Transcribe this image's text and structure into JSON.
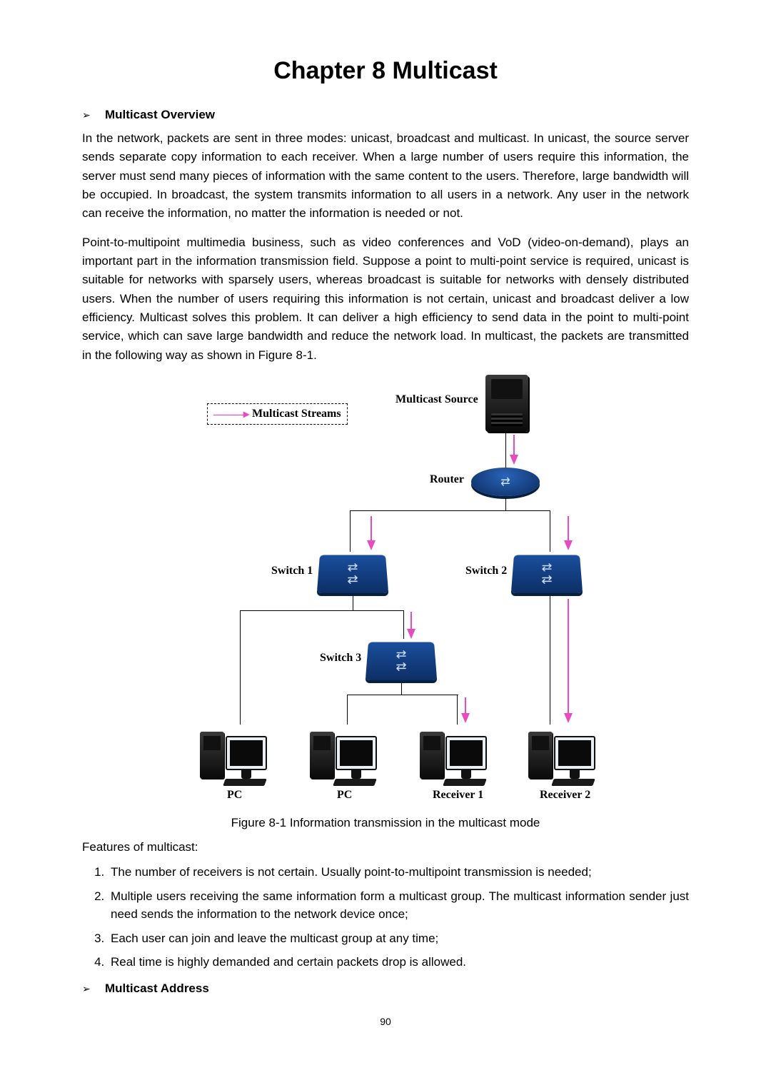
{
  "title": "Chapter 8  Multicast",
  "sections": {
    "overview_label": "Multicast Overview",
    "address_label": "Multicast Address"
  },
  "paragraphs": {
    "p1": "In the network, packets are sent in three modes: unicast, broadcast and multicast. In unicast, the source server sends separate copy information to each receiver. When a large number of users require this information, the server must send many pieces of information with the same content to the users. Therefore, large bandwidth will be occupied. In broadcast, the system transmits information to all users in a network. Any user in the network can receive the information, no matter the information is needed or not.",
    "p2": "Point-to-multipoint multimedia business, such as video conferences and VoD (video-on-demand), plays an important part in the information transmission field. Suppose a point to multi-point service is required, unicast is suitable for networks with sparsely users, whereas broadcast is suitable for networks with densely distributed users. When the number of users requiring this information is not certain, unicast and broadcast deliver a low efficiency. Multicast solves this problem. It can deliver a high efficiency to send data in the point to multi-point service, which can save large bandwidth and reduce the network load. In multicast, the packets are transmitted in the following way as shown in Figure 8-1."
  },
  "figure": {
    "caption": "Figure 8-1 Information transmission in the multicast mode",
    "legend": "Multicast Streams",
    "labels": {
      "source": "Multicast Source",
      "router": "Router",
      "switch1": "Switch 1",
      "switch2": "Switch 2",
      "switch3": "Switch 3",
      "pc": "PC",
      "receiver1": "Receiver 1",
      "receiver2": "Receiver 2"
    }
  },
  "features": {
    "intro": "Features of multicast:",
    "items": [
      "The number of receivers is not certain. Usually point-to-multipoint transmission is needed;",
      "Multiple users receiving the same information form a multicast group. The multicast information sender just need sends the information to the network device once;",
      "Each user can join and leave the multicast group at any time;",
      "Real time is highly demanded and certain packets drop is allowed."
    ]
  },
  "page_number": "90"
}
